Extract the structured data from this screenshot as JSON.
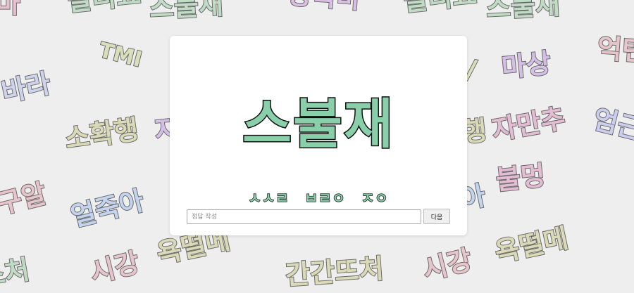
{
  "background_words": [
    {
      "text": "마",
      "color": "#e7b7c9"
    },
    {
      "text": "빨리요",
      "color": "#b8d9bf"
    },
    {
      "text": "스불재",
      "color": "#b8d9bf"
    },
    {
      "text": "양곡마",
      "color": "#d7b6e3"
    },
    {
      "text": "빨리요",
      "color": "#b8d9bf"
    },
    {
      "text": "스불재",
      "color": "#b8d9bf"
    },
    {
      "text": "TMI",
      "color": "#d6ddb0"
    },
    {
      "text": "바라",
      "color": "#c9d0ee"
    },
    {
      "text": "소확행",
      "color": "#d8d7ad"
    },
    {
      "text": "구알",
      "color": "#e8bfc5"
    },
    {
      "text": "얼죽아",
      "color": "#bcd0ee"
    },
    {
      "text": "시강",
      "color": "#e8bfc5"
    },
    {
      "text": "욕떨메",
      "color": "#d8d7ad"
    },
    {
      "text": "간간뜨처",
      "color": "#d8d7ad"
    },
    {
      "text": "시강",
      "color": "#e8bfc5"
    },
    {
      "text": "욕떨메",
      "color": "#d8d7ad"
    },
    {
      "text": "마상",
      "color": "#d2b7e6"
    },
    {
      "text": "억텐",
      "color": "#e8bfc5"
    },
    {
      "text": "자만추",
      "color": "#e3b4cf"
    },
    {
      "text": "엄근",
      "color": "#c6c9ee"
    },
    {
      "text": "불멍",
      "color": "#e3b4cf"
    },
    {
      "text": "스처",
      "color": "#b8d9bf"
    },
    {
      "text": "자",
      "color": "#d2b7e6"
    },
    {
      "text": "행",
      "color": "#d8d7ad"
    },
    {
      "text": "아",
      "color": "#bcd0ee"
    },
    {
      "text": "/",
      "color": "#d6ddb0"
    }
  ],
  "quiz": {
    "word": "스불재",
    "hint": "ㅅㅅㄹ ㅂㄹㅇ ㅈㅇ"
  },
  "answer": {
    "value": "",
    "placeholder": "정답 작성"
  },
  "next_label": "다음"
}
